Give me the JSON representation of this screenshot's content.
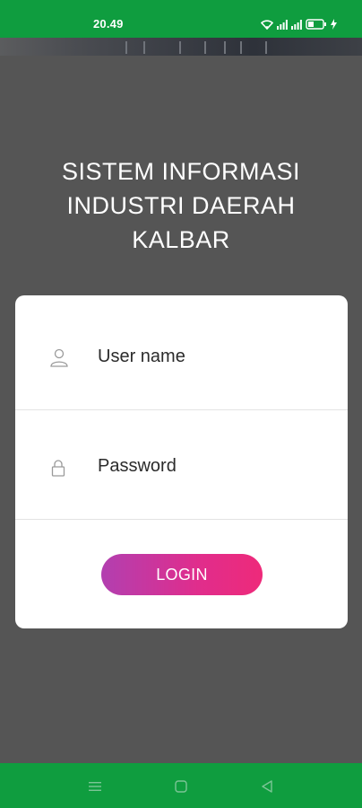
{
  "status_bar": {
    "time": "20.49",
    "icons": [
      "wifi-icon",
      "signal-icon",
      "signal-icon",
      "battery-icon",
      "charging-icon"
    ]
  },
  "app": {
    "title_lines": [
      "SISTEM INFORMASI",
      "INDUSTRI DAERAH",
      "KALBAR"
    ]
  },
  "login_form": {
    "username_placeholder": "User name",
    "username_icon": "user-icon",
    "password_placeholder": "Password",
    "password_icon": "lock-icon",
    "login_label": "LOGIN"
  },
  "nav_bar": {
    "buttons": [
      "menu-icon",
      "home-icon",
      "back-icon"
    ]
  },
  "colors": {
    "status_bar": "#0f9d3f",
    "background": "#555555",
    "card": "#ffffff",
    "button_gradient_start": "#b23fb0",
    "button_gradient_end": "#ee2a7a"
  }
}
